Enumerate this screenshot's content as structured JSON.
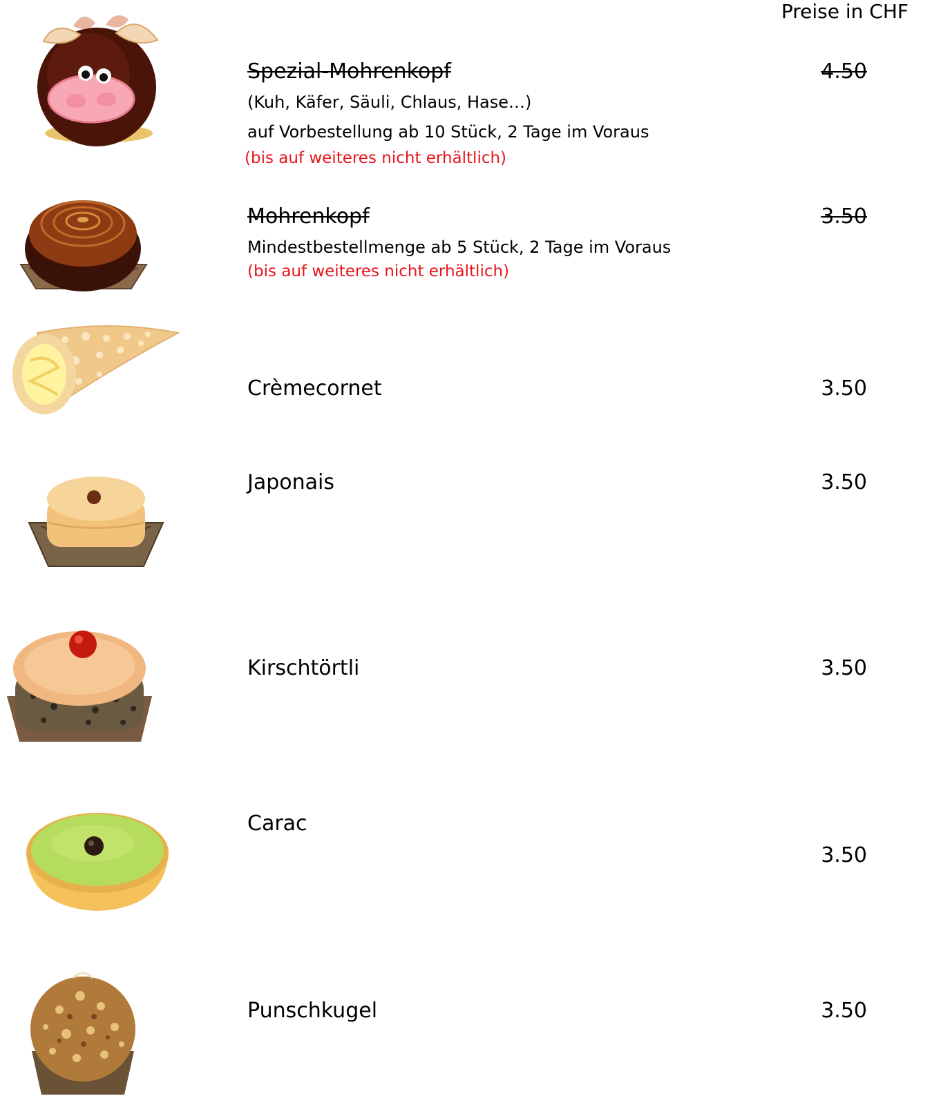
{
  "header": {
    "price_note": "Preise in CHF"
  },
  "colors": {
    "unavailable_note": "#e8141c"
  },
  "items": [
    {
      "name": "Spezial-Mohrenkopf",
      "details": [
        "(Kuh, Käfer, Säuli, Chlaus, Hase…)",
        "auf Vorbestellung ab 10 Stück, 2 Tage im Voraus"
      ],
      "note": "(bis auf weiteres nicht erhältlich)",
      "price": "4.50",
      "struck": true,
      "icon": "cow-marshmallow-cake-icon"
    },
    {
      "name": "Mohrenkopf",
      "details": [
        "Mindestbestellmenge ab 5 Stück, 2 Tage im Voraus"
      ],
      "note": "(bis auf weiteres nicht erhältlich)",
      "price": "3.50",
      "struck": true,
      "icon": "chocolate-dome-cake-icon"
    },
    {
      "name": "Crèmecornet",
      "price": "3.50",
      "struck": false,
      "icon": "cream-cornet-icon"
    },
    {
      "name": "Japonais",
      "price": "3.50",
      "struck": false,
      "icon": "japonais-cake-icon"
    },
    {
      "name": "Kirschtörtli",
      "price": "3.50",
      "struck": false,
      "icon": "cherry-tart-icon"
    },
    {
      "name": "Carac",
      "price": "3.50",
      "struck": false,
      "icon": "carac-tart-icon"
    },
    {
      "name": "Punschkugel",
      "price": "3.50",
      "struck": false,
      "icon": "punch-ball-icon"
    }
  ]
}
